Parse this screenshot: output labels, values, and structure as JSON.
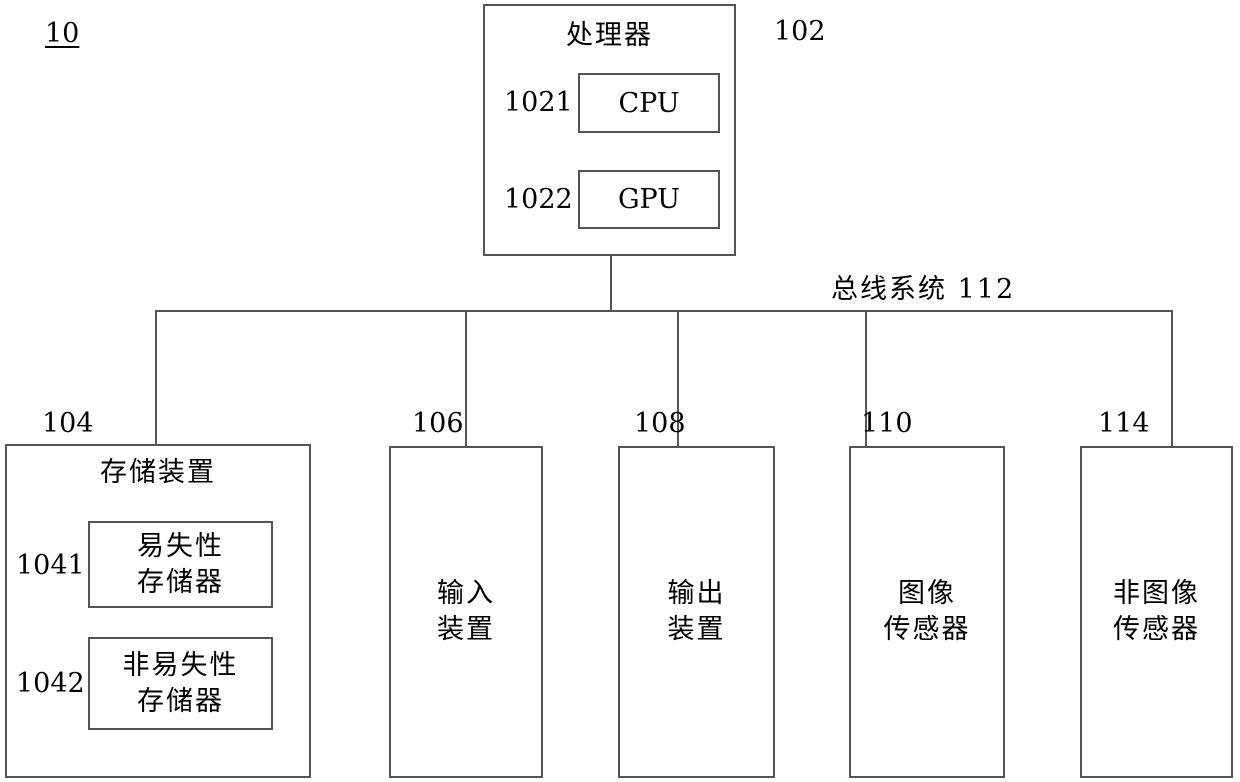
{
  "figure": {
    "number": "10"
  },
  "processor": {
    "title": "处理器",
    "ref": "102",
    "cpu": {
      "label": "CPU",
      "ref": "1021"
    },
    "gpu": {
      "label": "GPU",
      "ref": "1022"
    }
  },
  "bus": {
    "label": "总线系统 112"
  },
  "storage": {
    "title": "存储装置",
    "ref": "104",
    "volatile": {
      "label": "易失性\n存储器",
      "ref": "1041"
    },
    "nonvolatile": {
      "label": "非易失性\n存储器",
      "ref": "1042"
    }
  },
  "peripherals": [
    {
      "label": "输入\n装置",
      "ref": "106"
    },
    {
      "label": "输出\n装置",
      "ref": "108"
    },
    {
      "label": "图像\n传感器",
      "ref": "110"
    },
    {
      "label": "非图像\n传感器",
      "ref": "114"
    }
  ],
  "colors": {
    "stroke": "#555555",
    "text": "#000000",
    "background": "#ffffff"
  }
}
